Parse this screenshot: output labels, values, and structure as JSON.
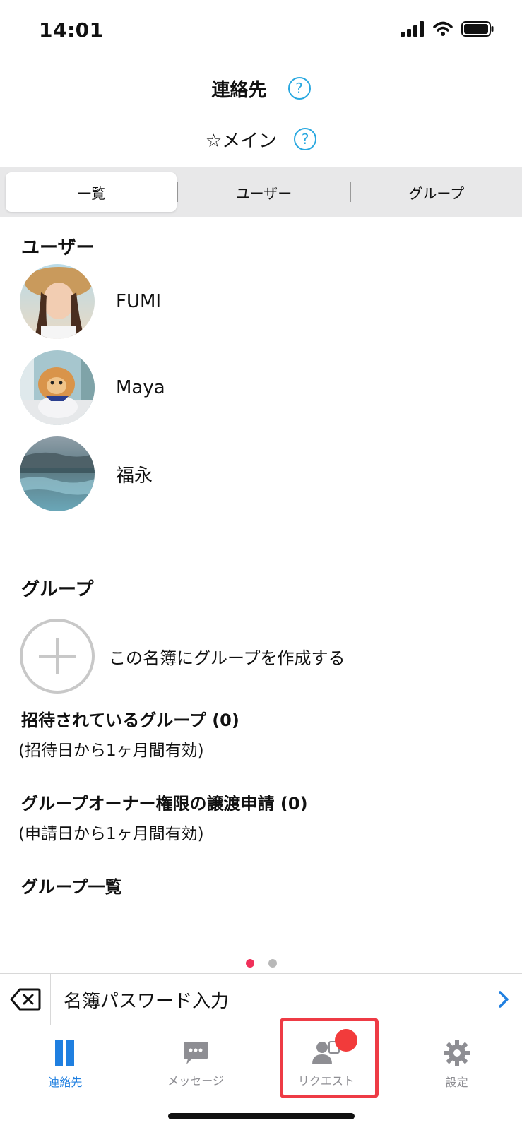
{
  "status": {
    "time": "14:01"
  },
  "header": {
    "title": "連絡先"
  },
  "book": {
    "name": "☆メイン"
  },
  "segments": {
    "list": "一覧",
    "users": "ユーザー",
    "groups": "グループ"
  },
  "users_section": {
    "heading": "ユーザー",
    "users": [
      {
        "name": "FUMI"
      },
      {
        "name": "Maya"
      },
      {
        "name": "福永"
      }
    ]
  },
  "groups_section": {
    "heading": "グループ",
    "create_label": "この名簿にグループを作成する",
    "invited_title": "招待されているグループ (0)",
    "invited_note": "(招待日から1ヶ月間有効)",
    "transfer_title": "グループオーナー権限の譲渡申請 (0)",
    "transfer_note": "(申請日から1ヶ月間有効)",
    "list_heading": "グループ一覧"
  },
  "password_bar": {
    "label": "名簿パスワード入力"
  },
  "tabs": [
    {
      "label": "連絡先",
      "icon": "contacts-icon",
      "active": true
    },
    {
      "label": "メッセージ",
      "icon": "message-icon",
      "active": false
    },
    {
      "label": "リクエスト",
      "icon": "request-icon",
      "active": false
    },
    {
      "label": "設定",
      "icon": "gear-icon",
      "active": false
    }
  ],
  "colors": {
    "accent": "#1f7fe0",
    "help": "#29a8e0",
    "inactive_tab": "#8e8e93",
    "dot_active": "#f0305a",
    "dot_inactive": "#b8b8b8",
    "highlight": "#ee3b45"
  }
}
